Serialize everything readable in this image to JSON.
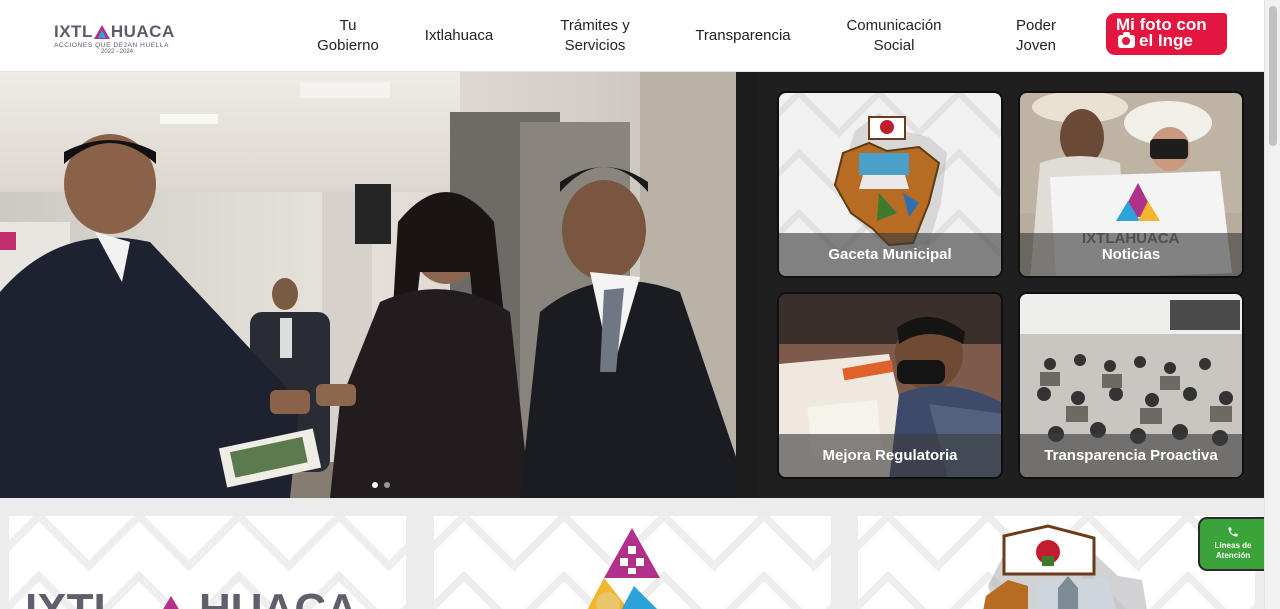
{
  "header": {
    "logo": {
      "name": "IXTLAHUACA",
      "name_left": "IXTL",
      "name_right": "HUACA",
      "tagline": "ACCIONES QUE DEJAN HUELLA",
      "years": "2022 - 2024"
    },
    "nav": [
      {
        "line1": "Tu",
        "line2": "Gobierno"
      },
      {
        "line1": "Ixtlahuaca",
        "line2": ""
      },
      {
        "line1": "Trámites y",
        "line2": "Servicios"
      },
      {
        "line1": "Transparencia",
        "line2": ""
      },
      {
        "line1": "Comunicación",
        "line2": "Social"
      },
      {
        "line1": "Poder",
        "line2": "Joven"
      }
    ],
    "photo_button": {
      "line1": "Mi foto con",
      "line2": "el Inge",
      "color": "#e3163f"
    }
  },
  "hero": {
    "slides": 2,
    "active_slide": 1
  },
  "tiles": [
    {
      "label": "Gaceta Municipal"
    },
    {
      "label": "Noticias"
    },
    {
      "label": "Mejora Regulatoria"
    },
    {
      "label": "Transparencia Proactiva"
    }
  ],
  "cards": [
    {
      "label": "IXTLAHUACA logo"
    },
    {
      "label": "Triangle emblem"
    },
    {
      "label": "Municipal shield"
    }
  ],
  "lineas": {
    "line1": "Líneas de",
    "line2": "Atención",
    "icon": "phone-icon",
    "color": "#3aa33a"
  },
  "colors": {
    "brand_red": "#e3163f",
    "panel_bg": "#1f1f1f",
    "accent_magenta": "#b0308a",
    "accent_blue": "#2ba2d8"
  }
}
